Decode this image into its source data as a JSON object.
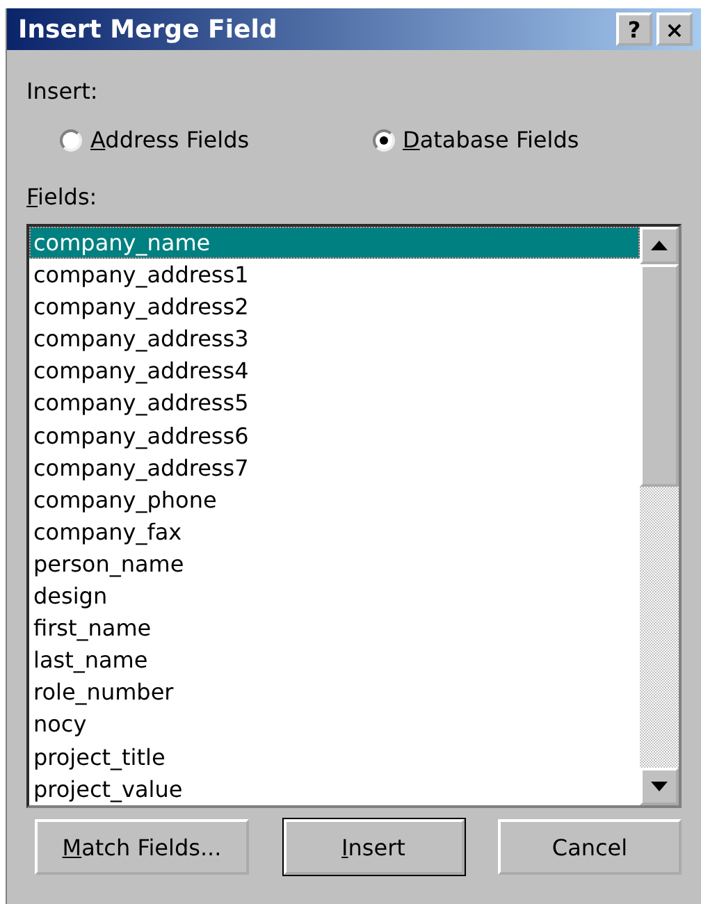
{
  "window": {
    "title": "Insert Merge Field",
    "title_buttons": [
      "?",
      "×"
    ]
  },
  "insert_group": {
    "label": "Insert:",
    "options": [
      {
        "label": "Address Fields",
        "underline_first": true,
        "selected": false
      },
      {
        "label": "Database Fields",
        "underline_first": true,
        "selected": true
      }
    ]
  },
  "fields": {
    "label": "Fields:",
    "underline_first": true,
    "items": [
      {
        "label": "company_name",
        "selected": true
      },
      {
        "label": "company_address1",
        "selected": false
      },
      {
        "label": "company_address2",
        "selected": false
      },
      {
        "label": "company_address3",
        "selected": false
      },
      {
        "label": "company_address4",
        "selected": false
      },
      {
        "label": "company_address5",
        "selected": false
      },
      {
        "label": "company_address6",
        "selected": false
      },
      {
        "label": "company_address7",
        "selected": false
      },
      {
        "label": "company_phone",
        "selected": false
      },
      {
        "label": "company_fax",
        "selected": false
      },
      {
        "label": "person_name",
        "selected": false
      },
      {
        "label": "design",
        "selected": false
      },
      {
        "label": "first_name",
        "selected": false
      },
      {
        "label": "last_name",
        "selected": false
      },
      {
        "label": "role_number",
        "selected": false
      },
      {
        "label": "nocy",
        "selected": false
      },
      {
        "label": "project_title",
        "selected": false
      },
      {
        "label": "project_value",
        "selected": false
      }
    ]
  },
  "buttons": [
    {
      "label": "Match Fields...",
      "underline_first": true,
      "default": false
    },
    {
      "label": "Insert",
      "underline_first": true,
      "default": true
    },
    {
      "label": "Cancel",
      "underline_first": false,
      "default": false
    }
  ]
}
